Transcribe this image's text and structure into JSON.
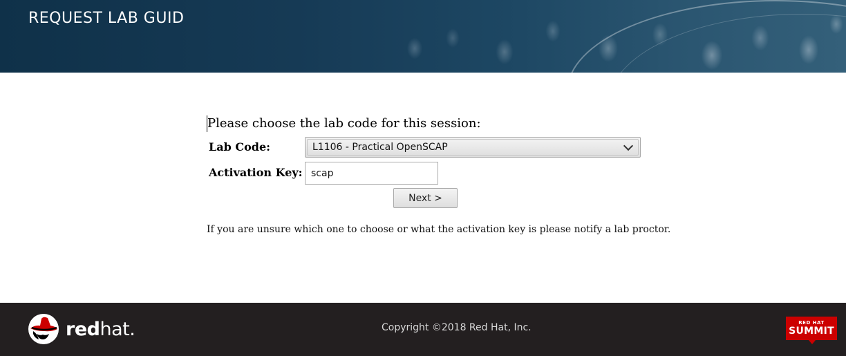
{
  "header": {
    "title": "REQUEST LAB GUID"
  },
  "form": {
    "prompt": "Please choose the lab code for this session:",
    "lab_code_label": "Lab Code:",
    "lab_code_selected": "L1106 - Practical OpenSCAP",
    "activation_key_label": "Activation Key:",
    "activation_key_value": "scap",
    "next_label": "Next >",
    "help_text": "If you are unsure which one to choose or what the activation key is please notify a lab proctor."
  },
  "footer": {
    "logo_text_bold": "red",
    "logo_text_light": "hat.",
    "copyright": "Copyright ©2018 Red Hat, Inc.",
    "badge_top": "RED HAT",
    "badge_main": "SUMMIT"
  },
  "colors": {
    "banner": "#163a55",
    "footer": "#231f20",
    "brand_red": "#cc0000"
  }
}
